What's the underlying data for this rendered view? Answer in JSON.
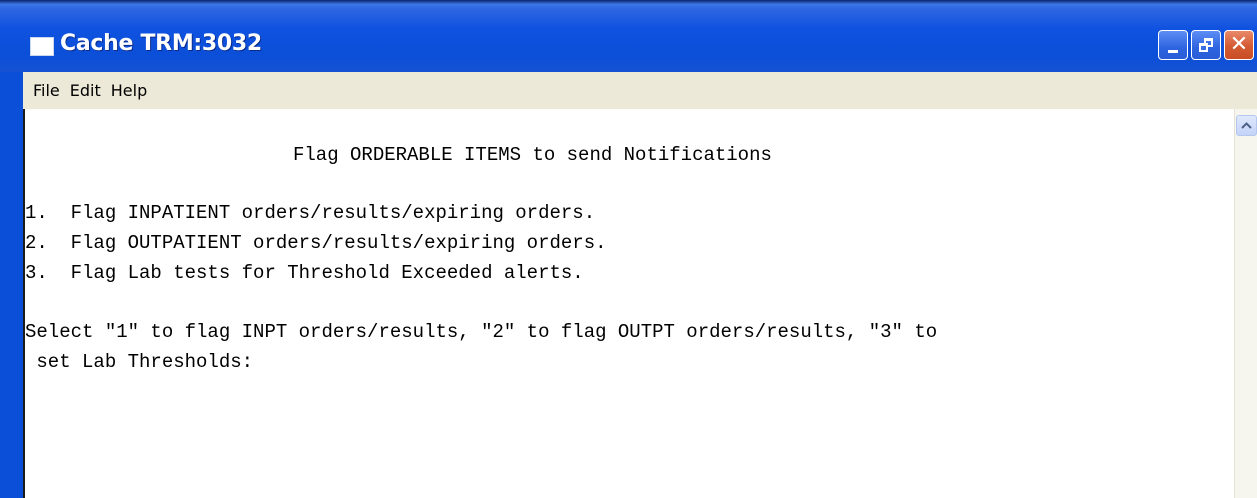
{
  "window": {
    "title": "Cache TRM:3032",
    "icon": "terminal-window-icon"
  },
  "controls": {
    "minimize_icon": "minimize-icon",
    "maximize_icon": "restore-icon",
    "close_icon": "close-icon",
    "close_glyph": "✕"
  },
  "menu": {
    "file": "File",
    "edit": "Edit",
    "help": "Help"
  },
  "terminal": {
    "heading": "Flag ORDERABLE ITEMS to send Notifications",
    "options": [
      "1.  Flag INPATIENT orders/results/expiring orders.",
      "2.  Flag OUTPATIENT orders/results/expiring orders.",
      "3.  Flag Lab tests for Threshold Exceeded alerts."
    ],
    "prompt_line1": "Select \"1\" to flag INPT orders/results, \"2\" to flag OUTPT orders/results, \"3\" to",
    "prompt_line2": " set Lab Thresholds:"
  },
  "scrollbar": {
    "up_icon": "scroll-up-arrow-icon"
  },
  "colors": {
    "titlebar": "#0b4fd8",
    "menubar": "#ece9d8",
    "close_button": "#d45a32"
  }
}
